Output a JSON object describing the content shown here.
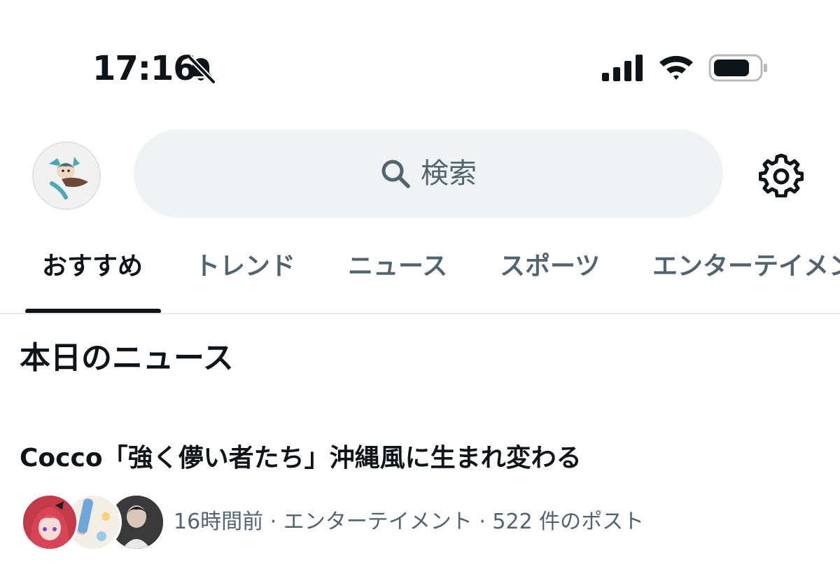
{
  "status_bar": {
    "time": "17:16",
    "icons": [
      "bell-slash-icon",
      "cellular-signal-icon",
      "wifi-icon",
      "battery-icon"
    ]
  },
  "header": {
    "avatar_icon": "profile-avatar",
    "search": {
      "placeholder": "検索",
      "icon": "search-icon"
    },
    "settings_icon": "gear-icon"
  },
  "tabs": [
    {
      "label": "おすすめ",
      "active": true
    },
    {
      "label": "トレンド",
      "active": false
    },
    {
      "label": "ニュース",
      "active": false
    },
    {
      "label": "スポーツ",
      "active": false
    },
    {
      "label": "エンターテイメント",
      "active": false
    }
  ],
  "section": {
    "title": "本日のニュース"
  },
  "news_item": {
    "headline": "Cocco「強く儚い者たち」沖縄風に生まれ変わる",
    "meta": "16時間前 · エンターテイメント · 522 件のポスト"
  },
  "colors": {
    "text_primary": "#0f1419",
    "text_secondary": "#536471",
    "search_bg": "#eff3f4",
    "divider": "#e4e6e8",
    "background": "#ffffff"
  }
}
